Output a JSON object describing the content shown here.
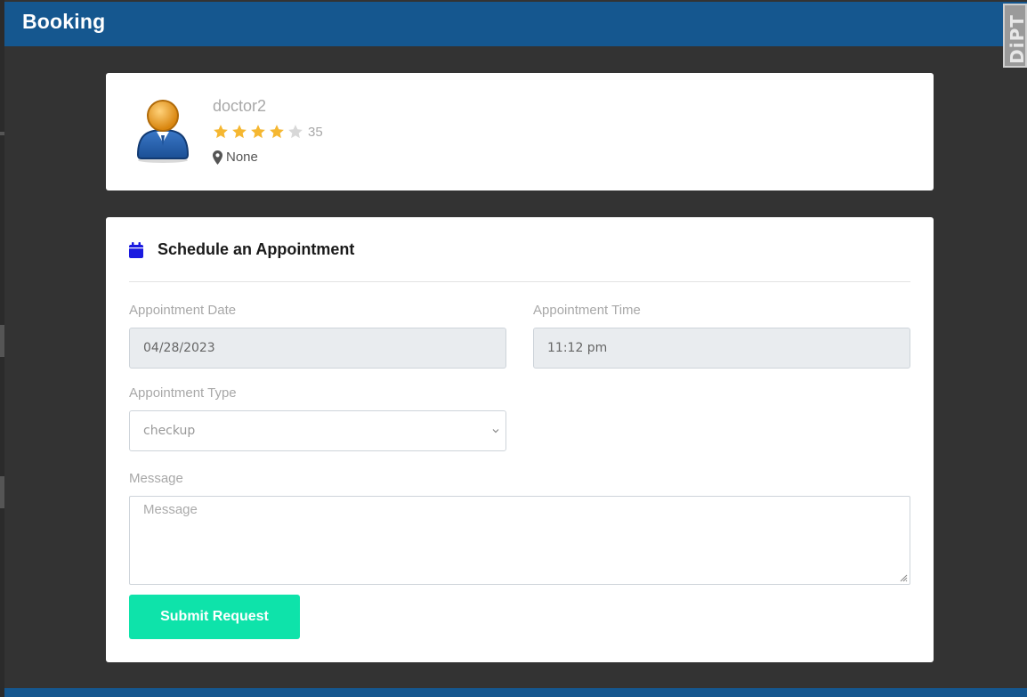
{
  "header": {
    "title": "Booking",
    "corner_badge_text": "DiPT"
  },
  "doctor": {
    "name": "doctor2",
    "rating": 4,
    "rating_max": 5,
    "rating_count": "35",
    "location": "None",
    "star_color": "#f5b731"
  },
  "appointment": {
    "heading": "Schedule an Appointment",
    "icon": "calendar-icon",
    "date": {
      "label": "Appointment Date",
      "value": "04/28/2023"
    },
    "time": {
      "label": "Appointment Time",
      "value": "11:12 pm"
    },
    "type": {
      "label": "Appointment Type",
      "value": "checkup"
    },
    "message": {
      "label": "Message",
      "placeholder": "Message"
    },
    "submit_label": "Submit Request"
  },
  "colors": {
    "header": "#15578f",
    "submit": "#0ee3aa",
    "calendar_icon": "#1a1ae0",
    "background": "#333333"
  }
}
